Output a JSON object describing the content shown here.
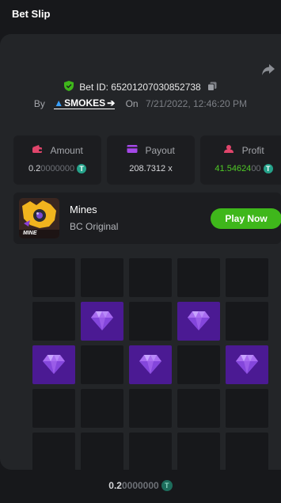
{
  "header": {
    "title": "Bet Slip"
  },
  "bet": {
    "id_label": "Bet ID: 65201207030852738",
    "by_label": "By",
    "user": "SMOKES",
    "on_label": "On",
    "date": "7/21/2022, 12:46:20 PM"
  },
  "stats": {
    "amount": {
      "label": "Amount",
      "value_main": "0.2",
      "value_dim": "0000000",
      "coin": "T"
    },
    "payout": {
      "label": "Payout",
      "value": "208.7312 x"
    },
    "profit": {
      "label": "Profit",
      "value_main": "41.54624",
      "value_dim": "00",
      "coin": "T"
    }
  },
  "game": {
    "name": "Mines",
    "subtitle": "BC Original",
    "thumb_label": "MINE",
    "play_label": "Play Now"
  },
  "grid": {
    "rows": 5,
    "cols": 5,
    "gems": [
      [
        1,
        1
      ],
      [
        1,
        3
      ],
      [
        2,
        0
      ],
      [
        2,
        2
      ],
      [
        2,
        4
      ]
    ]
  },
  "footer": {
    "value_main": "0.2",
    "value_dim": "0000000",
    "coin": "T"
  },
  "colors": {
    "accent_green": "#3fb71b",
    "gem_tile": "#4b1a93",
    "profit_green": "#4fc926",
    "coin": "#25a28a"
  },
  "icons": [
    "share-icon",
    "shield-check-icon",
    "copy-icon",
    "wallet-icon",
    "card-icon",
    "profit-icon",
    "tether-coin-icon",
    "gem-icon"
  ]
}
